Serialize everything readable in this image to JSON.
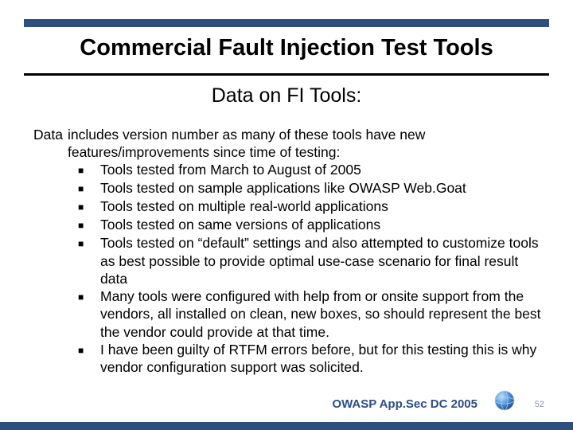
{
  "title": "Commercial Fault Injection Test Tools",
  "subtitle": "Data on FI Tools:",
  "intro_lead": "Data",
  "intro_rest": "includes version number as many of these tools have new features/improvements since time of testing:",
  "bullets": [
    "Tools tested from March to August of 2005",
    "Tools tested on sample applications like OWASP Web.Goat",
    "Tools tested on multiple real-world applications",
    "Tools tested on same versions of applications",
    "Tools tested on “default” settings and also attempted to customize tools as best possible to provide optimal use-case scenario for final result data",
    "Many tools were configured with help from or onsite support from the vendors, all installed on clean, new boxes, so should represent the best the vendor could provide at that time.",
    "I have been guilty of RTFM errors before, but for this testing this is why vendor configuration support was solicited."
  ],
  "footer": "OWASP App.Sec DC 2005",
  "page": "52"
}
